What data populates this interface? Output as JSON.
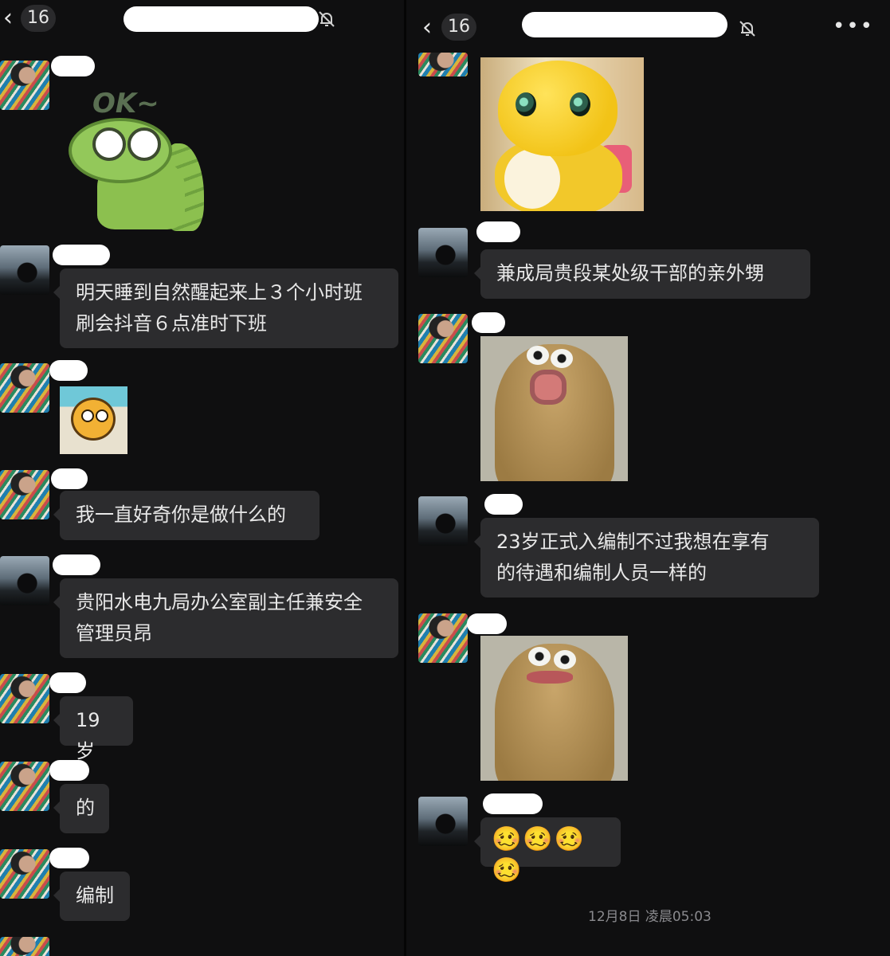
{
  "left": {
    "header": {
      "unread_count": "16"
    },
    "messages": [
      {
        "text": "明天睡到自然醒起来上３个小时班\n刷会抖音６点准时下班"
      },
      {
        "text": "我一直好奇你是做什么的"
      },
      {
        "text": "贵阳水电九局办公室副主任兼安全\n管理员昂"
      },
      {
        "text": "19岁"
      },
      {
        "text": "的"
      },
      {
        "text": "编制"
      }
    ],
    "sticker_caption": "OK~"
  },
  "right": {
    "header": {
      "unread_count": "16",
      "more": "•••"
    },
    "messages": [
      {
        "text": "兼成局贵段某处级干部的亲外甥"
      },
      {
        "text": "23岁正式入编制不过我想在享有\n的待遇和编制人员一样的"
      },
      {
        "text": "🥴🥴🥴🥴"
      }
    ],
    "timestamp": "12月8日 凌晨05:03"
  }
}
